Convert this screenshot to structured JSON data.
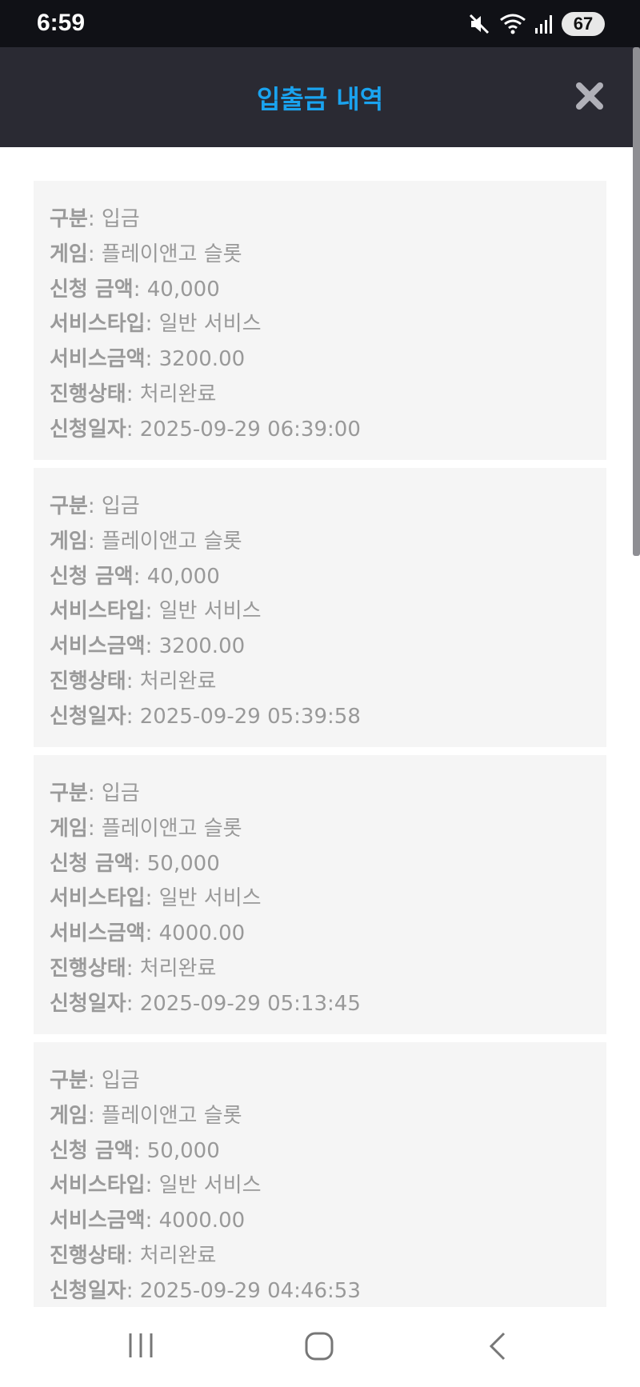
{
  "status_bar": {
    "time": "6:59",
    "battery": "67"
  },
  "header": {
    "title": "입출금 내역"
  },
  "labels": {
    "type": "구분",
    "game": "게임",
    "amount": "신청 금액",
    "service_type": "서비스타입",
    "service_amount": "서비스금액",
    "status": "진행상태",
    "date": "신청일자"
  },
  "records": [
    {
      "type": "입금",
      "game": "플레이앤고 슬롯",
      "amount": "40,000",
      "service_type": "일반 서비스",
      "service_amount": "3200.00",
      "status": "처리완료",
      "date": "2025-09-29 06:39:00"
    },
    {
      "type": "입금",
      "game": "플레이앤고 슬롯",
      "amount": "40,000",
      "service_type": "일반 서비스",
      "service_amount": "3200.00",
      "status": "처리완료",
      "date": "2025-09-29 05:39:58"
    },
    {
      "type": "입금",
      "game": "플레이앤고 슬롯",
      "amount": "50,000",
      "service_type": "일반 서비스",
      "service_amount": "4000.00",
      "status": "처리완료",
      "date": "2025-09-29 05:13:45"
    },
    {
      "type": "입금",
      "game": "플레이앤고 슬롯",
      "amount": "50,000",
      "service_type": "일반 서비스",
      "service_amount": "4000.00",
      "status": "처리완료",
      "date": "2025-09-29 04:46:53"
    }
  ],
  "icons": {
    "close": "close-icon",
    "mute": "mute-icon",
    "wifi": "wifi-icon",
    "signal": "signal-icon",
    "nav_recents": "recents-icon",
    "nav_home": "home-icon",
    "nav_back": "back-icon"
  },
  "colors": {
    "status_bar_bg": "#101116",
    "header_bg": "#2a2a33",
    "title": "#1aa3ef",
    "card_bg": "#f5f5f5",
    "text": "#999999"
  }
}
